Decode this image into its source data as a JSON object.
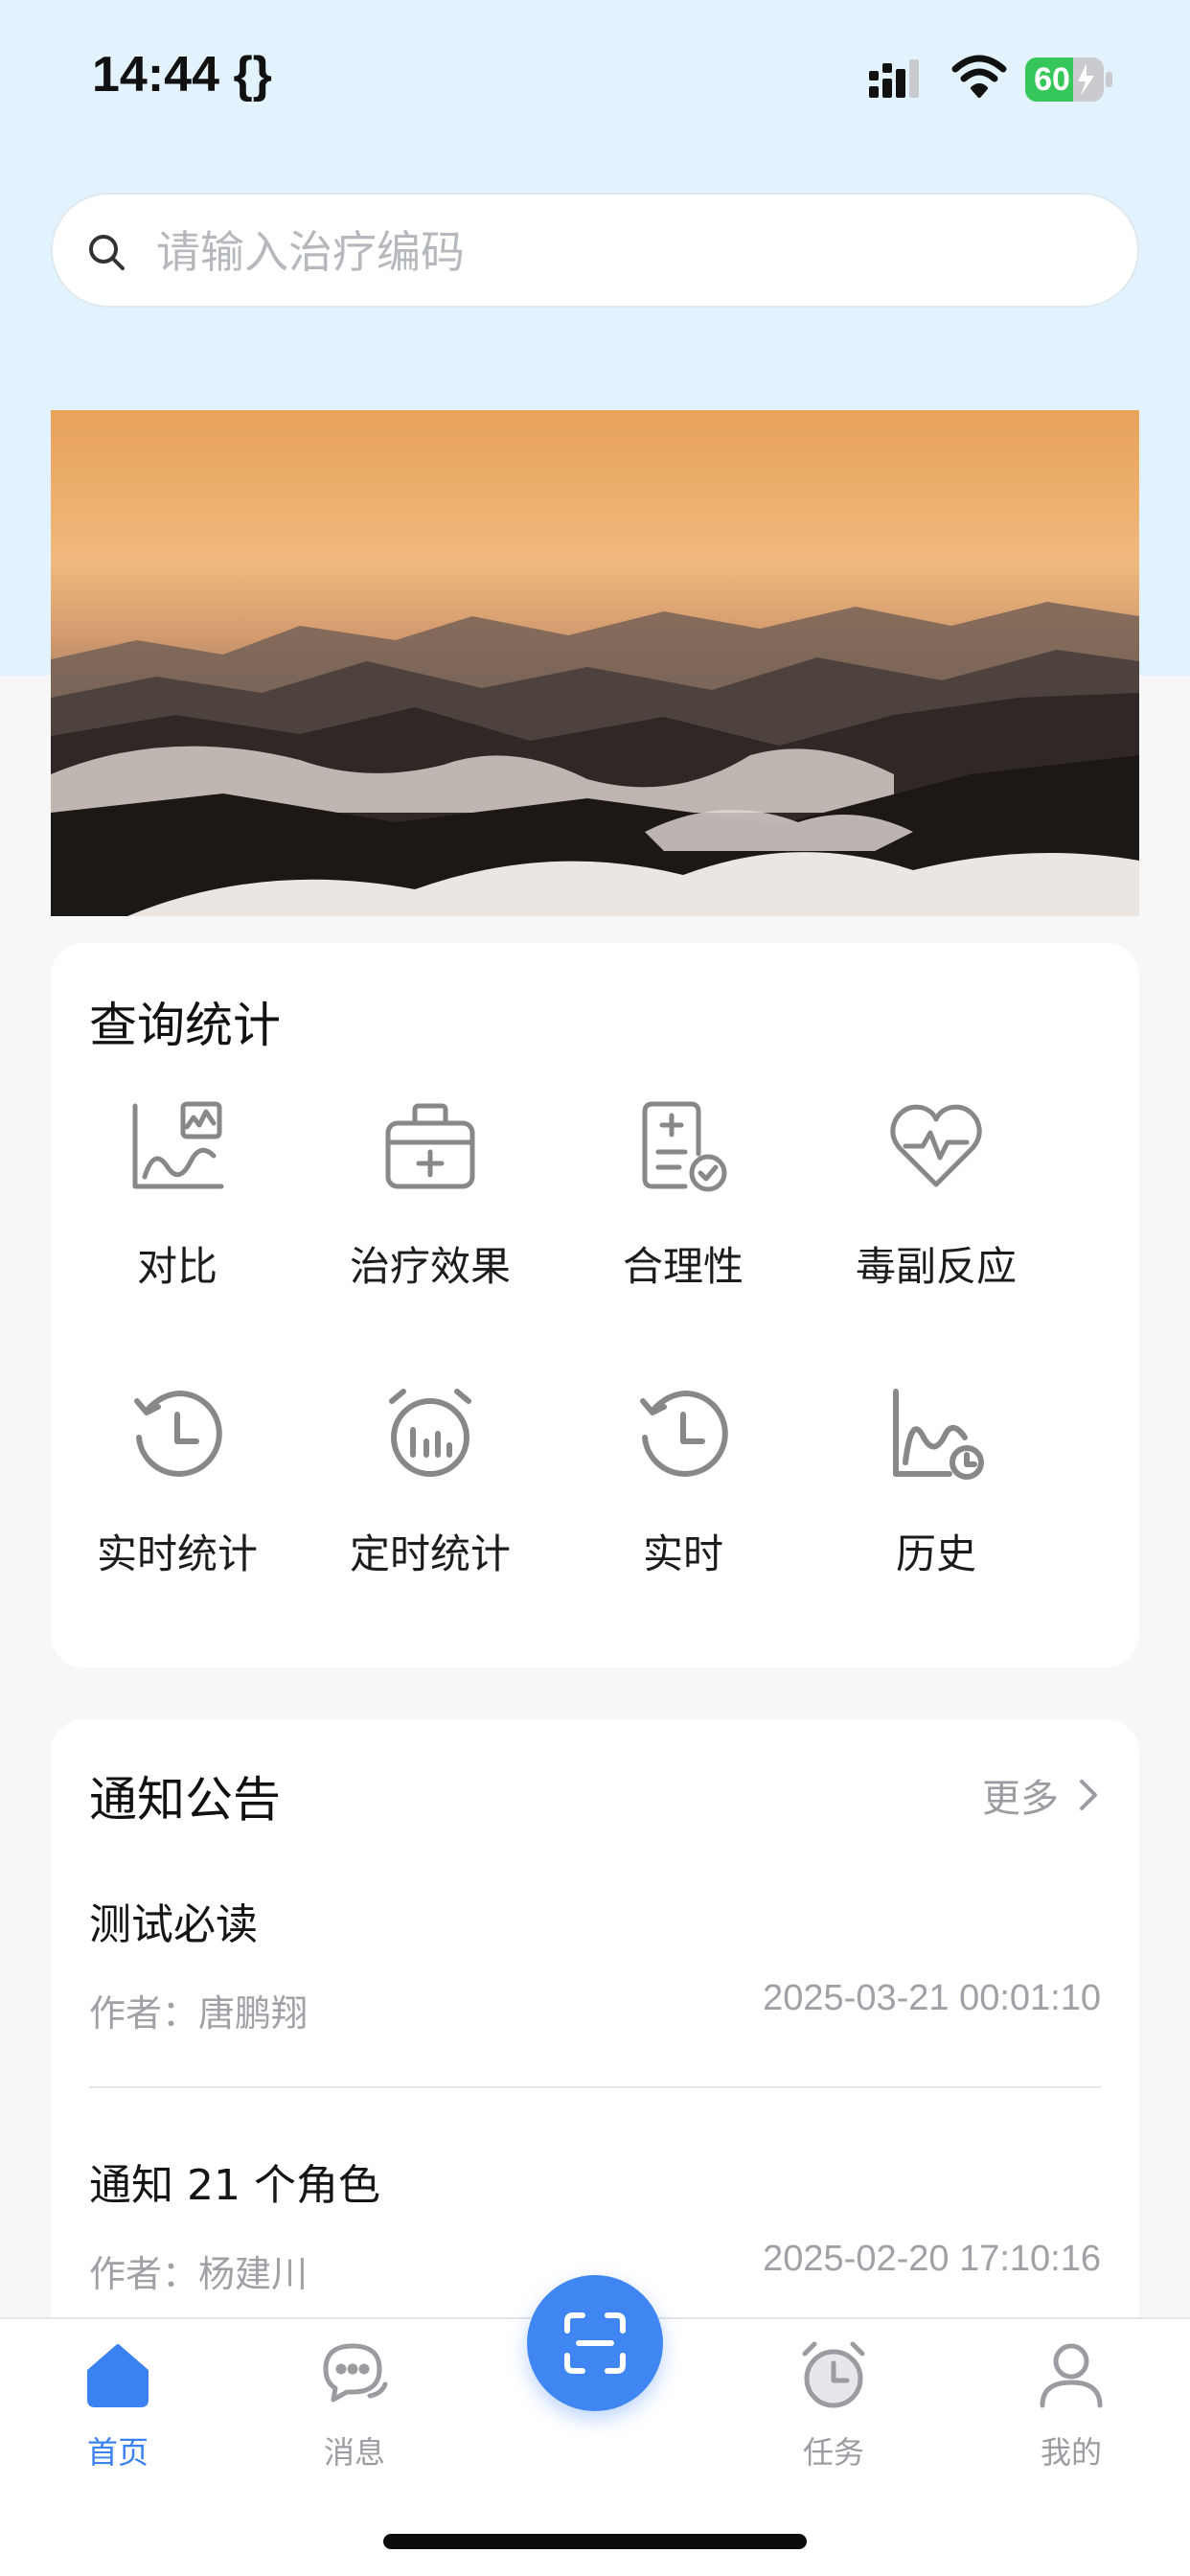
{
  "status_bar": {
    "time": "14:44 {}",
    "battery": "60"
  },
  "search": {
    "placeholder": "请输入治疗编码"
  },
  "stats": {
    "title": "查询统计",
    "items": [
      {
        "label": "对比",
        "icon": "compare-chart-icon"
      },
      {
        "label": "治疗效果",
        "icon": "medical-kit-icon"
      },
      {
        "label": "合理性",
        "icon": "checklist-icon"
      },
      {
        "label": "毒副反应",
        "icon": "heart-pulse-icon"
      },
      {
        "label": "实时统计",
        "icon": "history-clock-icon"
      },
      {
        "label": "定时统计",
        "icon": "alarm-chart-icon"
      },
      {
        "label": "实时",
        "icon": "history-clock-icon"
      },
      {
        "label": "历史",
        "icon": "history-chart-icon"
      }
    ]
  },
  "notices": {
    "title": "通知公告",
    "more": "更多",
    "items": [
      {
        "title": "测试必读",
        "author": "作者：唐鹏翔",
        "time": "2025-03-21 00:01:10"
      },
      {
        "title": "通知 21 个角色",
        "author": "作者：杨建川",
        "time": "2025-02-20 17:10:16"
      }
    ]
  },
  "tabs": [
    {
      "label": "首页",
      "icon": "home-icon",
      "active": true
    },
    {
      "label": "消息",
      "icon": "chat-icon",
      "active": false
    },
    {
      "label": "任务",
      "icon": "alarm-clock-icon",
      "active": false
    },
    {
      "label": "我的",
      "icon": "user-icon",
      "active": false
    }
  ],
  "colors": {
    "accent": "#3f86f3",
    "header_bg": "#e3f3fd",
    "page_bg": "#f7f7f8"
  }
}
